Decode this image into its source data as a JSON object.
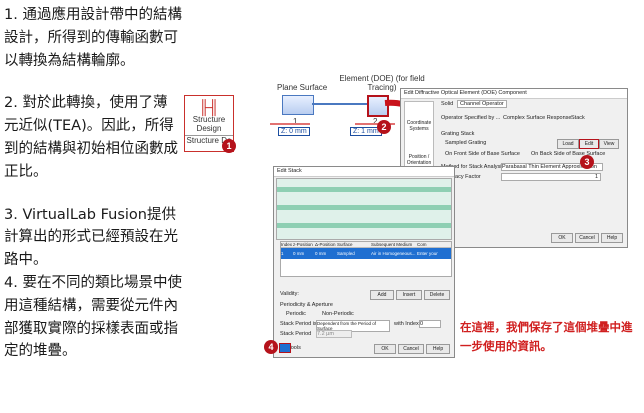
{
  "steps": [
    "1. 通過應用設計帶中的結構設計，所得到的傳輸函數可以轉換為結構輪廓。",
    "2. 對於此轉換，使用了薄元近似(TEA)。因此，所得到的結構與初始相位函數成正比。",
    "3. VirtualLab Fusion提供計算出的形式已經預設在光路中。",
    "4. 要在不同的類比場景中使用這種結構，需要從元件內部獲取實際的採樣表面或指定的堆疊。"
  ],
  "icon": {
    "label_line1": "Structure",
    "label_line2": "Design",
    "label_line3": "Structure De"
  },
  "badges": [
    "1",
    "2",
    "3",
    "4"
  ],
  "diagram": {
    "plane_surface": "Plane Surface",
    "element_label": "Element (DOE) (for field Tracing)",
    "index_1": "1",
    "index_2": "2",
    "dist_1": "Z: 0 mm",
    "dist_2": "Z: 1 mm"
  },
  "dialog_component": {
    "title": "Edit Diffractive Optical Element (DOE) Component",
    "tab_solid": "Solid",
    "tab_channel": "Channel Operator",
    "side_coordinate": "Coordinate Systems",
    "side_position": "Position / Orientation",
    "operator_label": "Operator Specified by ...",
    "opt_complex": "Complex Surface Response",
    "opt_stack": "Stack",
    "grating_stack": "Grating Stack",
    "sampled_grating": "Sampled Grating",
    "btn_load": "Load",
    "btn_edit": "Edit",
    "btn_view": "View",
    "front_side": "On Front Side of Base Surface",
    "back_side": "On Back Side of Base Surface",
    "method_label": "Method for Stack Analysis",
    "method_value": "Parabasal Thin Element Approximation",
    "accuracy_label": "Accuracy Factor",
    "accuracy_value": "1"
  },
  "dialog_stack": {
    "title": "Edit Stack",
    "headers": [
      "Index",
      "z-Position",
      "Δ-Position",
      "Surface",
      "Subsequent Medium",
      "Com"
    ],
    "row": [
      "1",
      "0 mm",
      "0 mm",
      "Sampled Surface",
      "Air in Homogeneous...",
      "Enter your comment"
    ],
    "validity": "Validity:",
    "btn_add": "Add",
    "btn_insert": "Insert",
    "btn_delete": "Delete",
    "periodicity": "Periodicity & Aperture",
    "periodic": "Periodic",
    "non_periodic": "Non-Periodic",
    "stack_period_is": "Stack Period is",
    "period_source": "Dependent from the Period of Surface",
    "with_index": "with Index",
    "index_value": "0",
    "stack_period": "Stack Period",
    "period_value": "7.2 µm",
    "tools": "Tools",
    "ok": "OK",
    "cancel": "Cancel",
    "help": "Help"
  },
  "note": "在這裡，我們保存了這個堆疊中進一步使用的資訊。",
  "colors": {
    "accent_red": "#c9302c",
    "badge": "#b5121b",
    "note_red": "#d01f1f",
    "teal": "#8ecfb3",
    "blue_row": "#1f6fd1"
  }
}
